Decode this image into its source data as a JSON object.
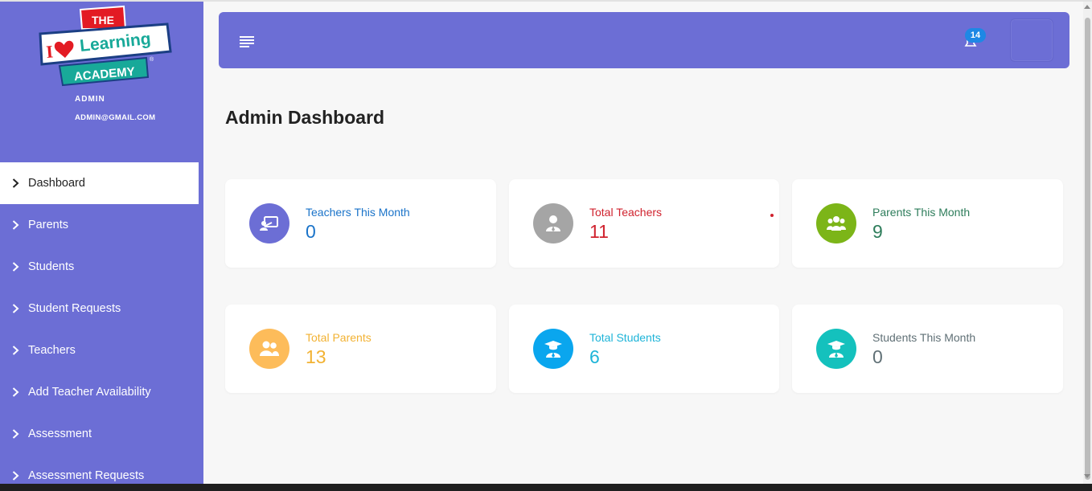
{
  "colors": {
    "sidebar": "#6c6ed5",
    "header": "#6c6ed5",
    "badge": "#1e88e5"
  },
  "sidebar": {
    "logo": {
      "line1": "THE",
      "line2": "I",
      "line3": "Learning",
      "line4": "ACADEMY"
    },
    "user_role": "ADMIN",
    "user_email": "ADMIN@GMAIL.COM",
    "items": [
      {
        "label": "Dashboard",
        "active": true
      },
      {
        "label": "Parents"
      },
      {
        "label": "Students"
      },
      {
        "label": "Student Requests"
      },
      {
        "label": "Teachers"
      },
      {
        "label": "Add Teacher Availability"
      },
      {
        "label": "Assessment"
      },
      {
        "label": "Assessment Requests"
      }
    ]
  },
  "header": {
    "menu_icon": "menu-icon",
    "notification_icon": "bell-icon",
    "notification_count": "14"
  },
  "main": {
    "title": "Admin Dashboard",
    "cards": [
      {
        "label": "Teachers This Month",
        "value": "0",
        "color": "#1a73c9",
        "icon_bg": "#6c6ed5",
        "icon": "teacher-board-icon"
      },
      {
        "label": "Total Teachers",
        "value": "11",
        "color": "#d0222e",
        "icon_bg": "#a5a5a5",
        "icon": "user-icon"
      },
      {
        "label": "Parents This Month",
        "value": "9",
        "color": "#2e7d5b",
        "icon_bg": "#7cb518",
        "icon": "users-group-icon"
      },
      {
        "label": "Total Parents",
        "value": "13",
        "color": "#f2b233",
        "icon_bg": "#fdbc5a",
        "icon": "users-icon"
      },
      {
        "label": "Total Students",
        "value": "6",
        "color": "#1eb4d8",
        "icon_bg": "#0aa6ee",
        "icon": "graduate-icon"
      },
      {
        "label": "Students This Month",
        "value": "0",
        "color": "#607076",
        "icon_bg": "#14c1bd",
        "icon": "graduate-icon"
      }
    ]
  }
}
